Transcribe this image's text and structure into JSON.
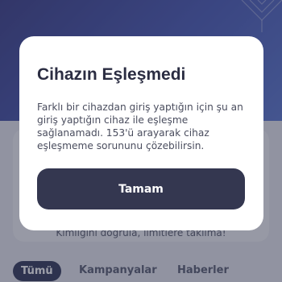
{
  "background": {
    "hint_text": "Kimliğini doğrula, limitlere takılma!",
    "tabs": [
      {
        "label": "Tümü",
        "active": true
      },
      {
        "label": "Kampanyalar",
        "active": false
      },
      {
        "label": "Haberler",
        "active": false
      }
    ]
  },
  "dialog": {
    "title": "Cihazın Eşleşmedi",
    "message": "Farklı bir cihazdan giriş yaptığın için şu an giriş yaptığın cihaz ile eşleşme sağlanamadı. 153'ü arayarak cihaz eşleşmeme sorununu çözebilirsin.",
    "button_label": "Tamam"
  },
  "colors": {
    "hero_gradient_start": "#3b3f88",
    "hero_gradient_end": "#5c78cf",
    "button_background": "#343750",
    "title_text": "#2b2d42",
    "active_tab": "#343a5a"
  }
}
